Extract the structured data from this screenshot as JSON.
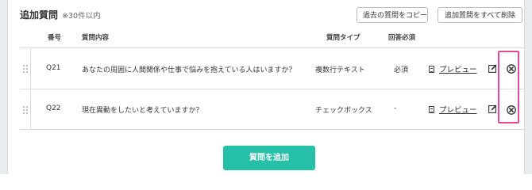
{
  "section": {
    "title": "追加質問",
    "note": "※30件以内"
  },
  "toolbar": {
    "copy_label": "過去の質問をコピー",
    "delete_all_label": "追加質問をすべて削除"
  },
  "table": {
    "headers": {
      "number": "番号",
      "content": "質問内容",
      "type": "質問タイプ",
      "required": "回答必須"
    },
    "rows": [
      {
        "number": "Q21",
        "content": "あなたの周囲に人間関係や仕事で悩みを抱えている人はいますか？",
        "type": "複数行テキスト",
        "required": "必須",
        "preview": "プレビュー"
      },
      {
        "number": "Q22",
        "content": "現在異動をしたいと考えていますか？",
        "type": "チェックボックス",
        "required": "-",
        "preview": "プレビュー"
      }
    ]
  },
  "add_button": {
    "label": "質問を追加"
  },
  "colors": {
    "accent": "#26c0a8",
    "highlight": "#e6499a"
  }
}
